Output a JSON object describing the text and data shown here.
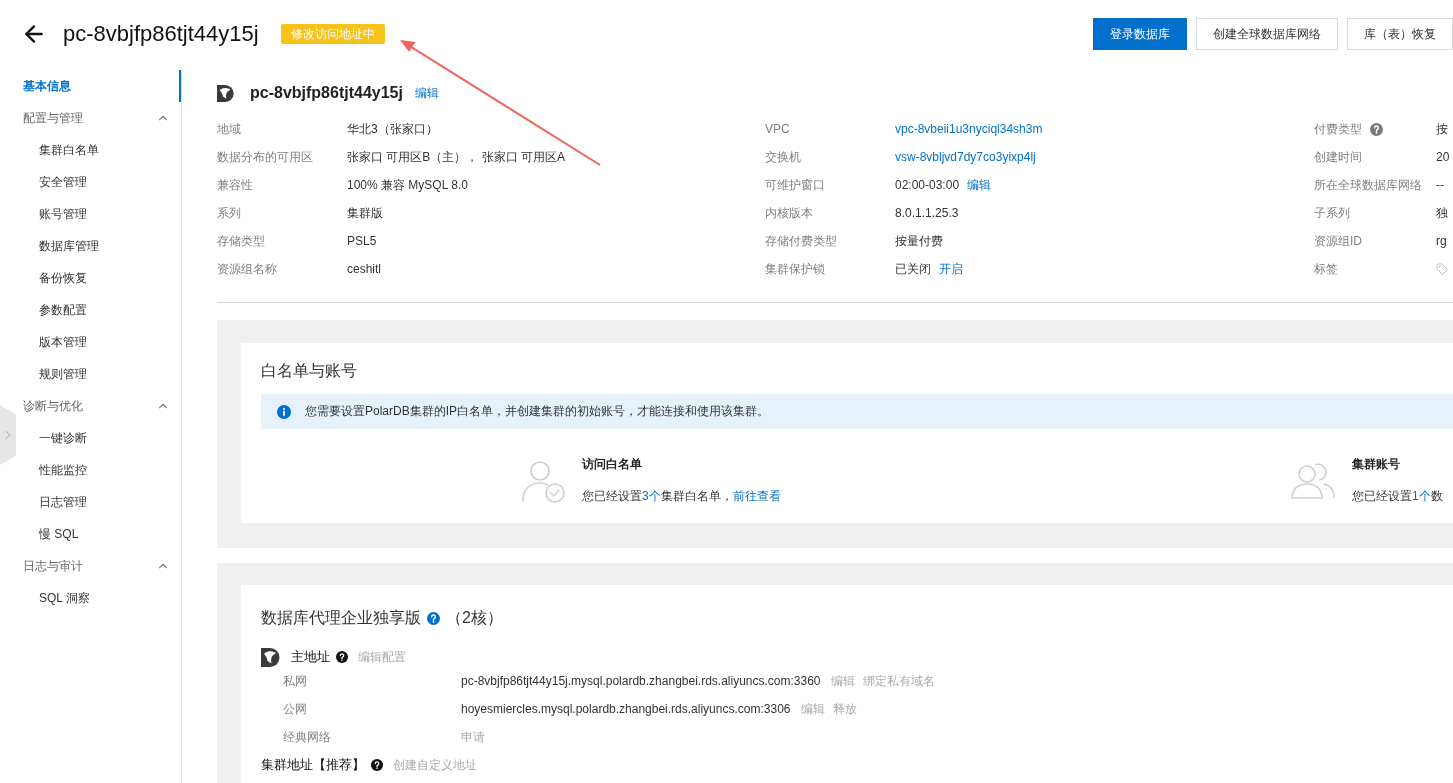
{
  "header": {
    "title": "pc-8vbjfp86tjt44y15j",
    "status": "修改访问地址中",
    "buttons": [
      {
        "label": "登录数据库",
        "kind": "primary"
      },
      {
        "label": "创建全球数据库网络",
        "kind": "default"
      },
      {
        "label": "库（表）恢复",
        "kind": "default"
      }
    ]
  },
  "sidebar": {
    "items": [
      {
        "kind": "link",
        "label": "基本信息",
        "selected": true
      },
      {
        "kind": "group",
        "label": "配置与管理",
        "expanded": true,
        "children": [
          {
            "label": "集群白名单",
            "selected": false
          },
          {
            "label": "安全管理",
            "selected": false
          },
          {
            "label": "账号管理",
            "selected": false
          },
          {
            "label": "数据库管理",
            "selected": false
          },
          {
            "label": "备份恢复",
            "selected": false
          },
          {
            "label": "参数配置",
            "selected": false
          },
          {
            "label": "版本管理",
            "selected": false
          },
          {
            "label": "规则管理",
            "selected": false
          }
        ]
      },
      {
        "kind": "group",
        "label": "诊断与优化",
        "expanded": true,
        "children": [
          {
            "label": "一键诊断",
            "selected": false
          },
          {
            "label": "性能监控",
            "selected": false
          },
          {
            "label": "日志管理",
            "selected": false
          },
          {
            "label": "慢 SQL",
            "selected": false
          }
        ]
      },
      {
        "kind": "group",
        "label": "日志与审计",
        "expanded": true,
        "children": [
          {
            "label": "SQL 洞察",
            "selected": false
          }
        ]
      }
    ]
  },
  "cluster_info": {
    "name": "pc-8vbjfp86tjt44y15j",
    "edit_link": "编辑",
    "fields": [
      {
        "label": "地域",
        "kind": "text",
        "value": "华北3（张家口）",
        "help": false
      },
      {
        "label": "VPC",
        "kind": "link",
        "value": "vpc-8vbeii1u3nyciql34sh3m",
        "help": false
      },
      {
        "label": "付费类型",
        "kind": "text",
        "value": "按",
        "help": true
      },
      {
        "label": "数据分布的可用区",
        "kind": "text",
        "value": "张家口 可用区B（主）， 张家口 可用区A",
        "help": false
      },
      {
        "label": "交换机",
        "kind": "link",
        "value": "vsw-8vbljvd7dy7co3yixp4lj",
        "help": false
      },
      {
        "label": "创建时间",
        "kind": "text",
        "value": "20",
        "help": false
      },
      {
        "label": "兼容性",
        "kind": "text",
        "value": "100% 兼容 MySQL 8.0",
        "help": false
      },
      {
        "label": "可维护窗口",
        "kind": "text",
        "value": "02:00-03:00",
        "action": "编辑",
        "help": false
      },
      {
        "label": "所在全球数据库网络",
        "kind": "text",
        "value": "--",
        "help": false
      },
      {
        "label": "系列",
        "kind": "text",
        "value": "集群版",
        "help": false
      },
      {
        "label": "内核版本",
        "kind": "text",
        "value": "8.0.1.1.25.3",
        "help": false
      },
      {
        "label": "子系列",
        "kind": "text",
        "value": "独",
        "help": false
      },
      {
        "label": "存储类型",
        "kind": "text",
        "value": "PSL5",
        "help": false
      },
      {
        "label": "存储付费类型",
        "kind": "text",
        "value": "按量付费",
        "help": false
      },
      {
        "label": "资源组ID",
        "kind": "text",
        "value": "rg",
        "help": false
      },
      {
        "label": "资源组名称",
        "kind": "text",
        "value": "ceshitl",
        "help": false
      },
      {
        "label": "集群保护锁",
        "kind": "text",
        "value": "已关闭",
        "action": "开启",
        "help": false
      },
      {
        "label": "标签",
        "kind": "tag",
        "help": false
      }
    ]
  },
  "access": {
    "title": "白名单与账号",
    "notice": "您需要设置PolarDB集群的IP白名单，并创建集群的初始账号，才能连接和使用该集群。",
    "items": [
      {
        "kind": "whitelist",
        "title": "访问白名单",
        "before": "您已经设置",
        "count": "3个",
        "after": "集群白名单，",
        "link": "前往查看"
      },
      {
        "kind": "account",
        "title": "集群账号",
        "before": "您已经设置",
        "count": "1个",
        "after": "数"
      }
    ]
  },
  "proxy": {
    "title": "数据库代理企业独享版",
    "help": true,
    "suffix": "（2核）",
    "endpoints": [
      {
        "name": "主地址",
        "icon": true,
        "help": true,
        "action": {
          "label": "编辑配置",
          "disabled": true
        },
        "rows": [
          {
            "network": "私网",
            "address": "pc-8vbjfp86tjt44y15j.mysql.polardb.zhangbei.rds.aliyuncs.com:3360",
            "actions": [
              {
                "label": "编辑",
                "disabled": true
              },
              {
                "label": "绑定私有域名",
                "disabled": true
              }
            ]
          },
          {
            "network": "公网",
            "address": "hoyesmiercles.mysql.polardb.zhangbei.rds.aliyuncs.com:3306",
            "actions": [
              {
                "label": "编辑",
                "disabled": true
              },
              {
                "label": "释放",
                "disabled": true
              }
            ]
          },
          {
            "network": "经典网络",
            "actions": [
              {
                "label": "申请",
                "disabled": true
              }
            ]
          }
        ]
      },
      {
        "name": "集群地址【推荐】",
        "icon": false,
        "help": true,
        "action": {
          "label": "创建自定义地址",
          "disabled": true
        }
      }
    ]
  }
}
